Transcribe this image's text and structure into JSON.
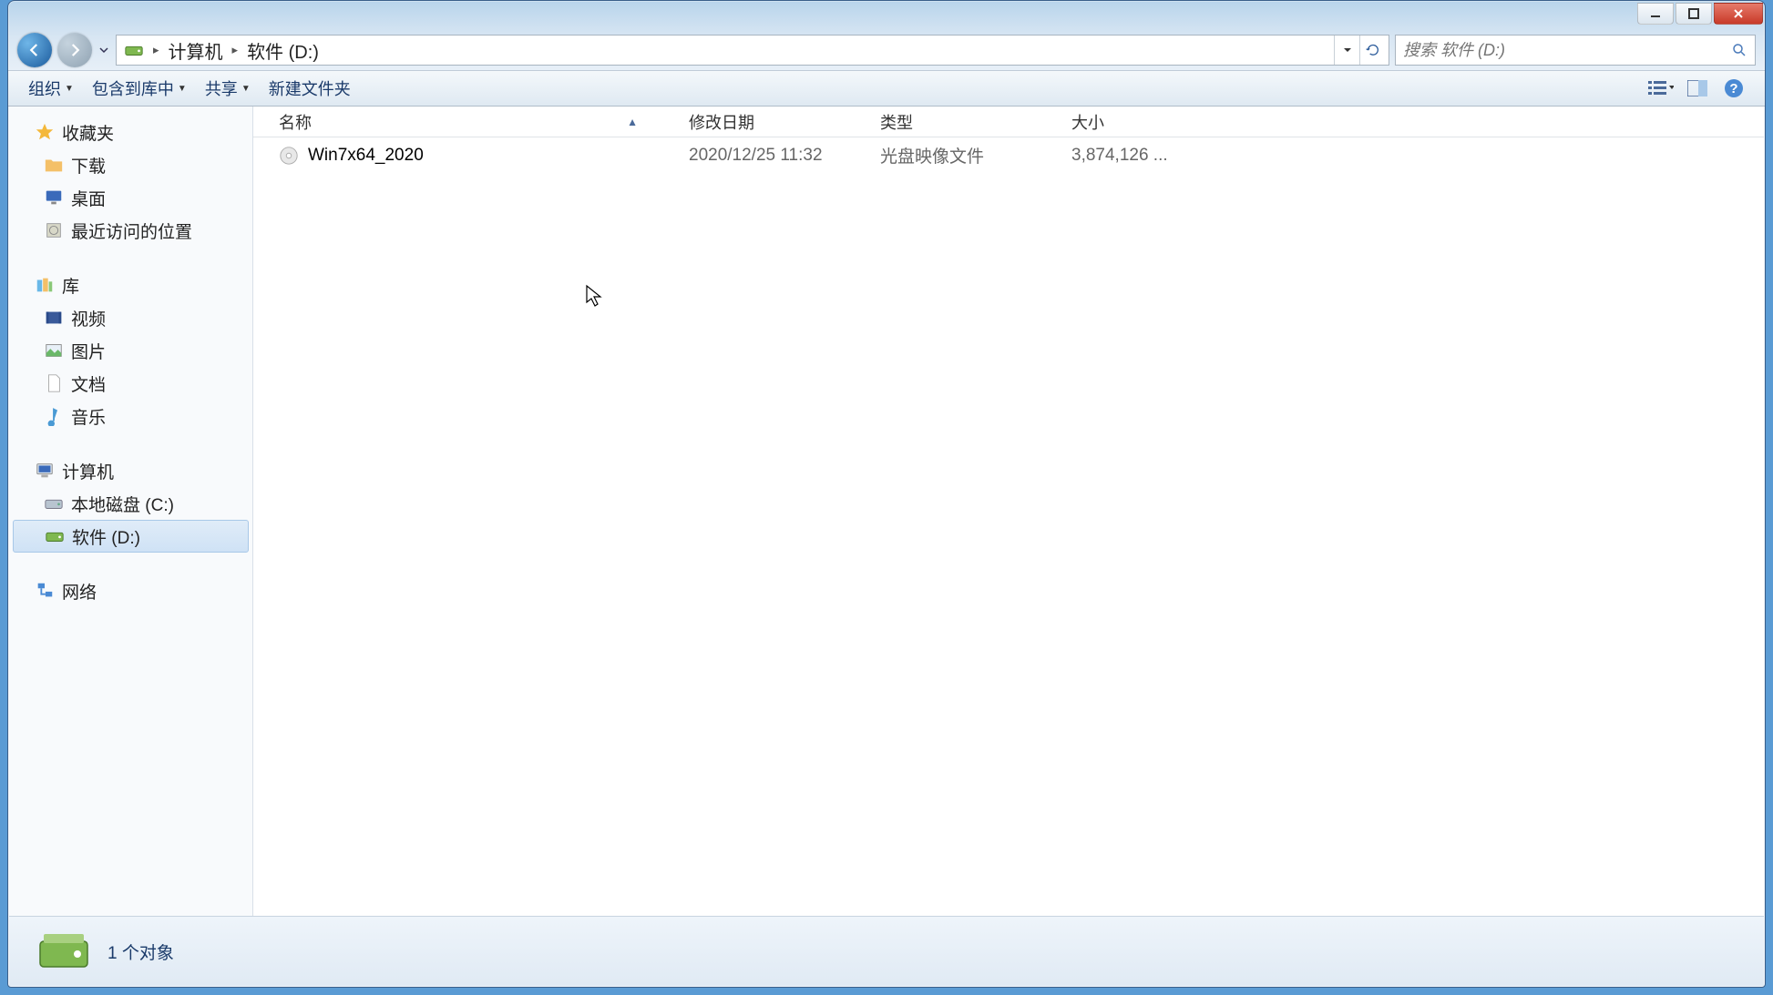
{
  "breadcrumb": {
    "part1": "计算机",
    "part2": "软件 (D:)"
  },
  "search": {
    "placeholder": "搜索 软件 (D:)"
  },
  "toolbar": {
    "organize": "组织",
    "include": "包含到库中",
    "share": "共享",
    "newfolder": "新建文件夹"
  },
  "columns": {
    "name": "名称",
    "date": "修改日期",
    "type": "类型",
    "size": "大小"
  },
  "sidebar": {
    "favorites": "收藏夹",
    "downloads": "下载",
    "desktop": "桌面",
    "recent": "最近访问的位置",
    "libraries": "库",
    "videos": "视频",
    "pictures": "图片",
    "documents": "文档",
    "music": "音乐",
    "computer": "计算机",
    "localC": "本地磁盘 (C:)",
    "softwareD": "软件 (D:)",
    "network": "网络"
  },
  "files": [
    {
      "name": "Win7x64_2020",
      "date": "2020/12/25 11:32",
      "type": "光盘映像文件",
      "size": "3,874,126 ..."
    }
  ],
  "status": {
    "text": "1 个对象"
  }
}
